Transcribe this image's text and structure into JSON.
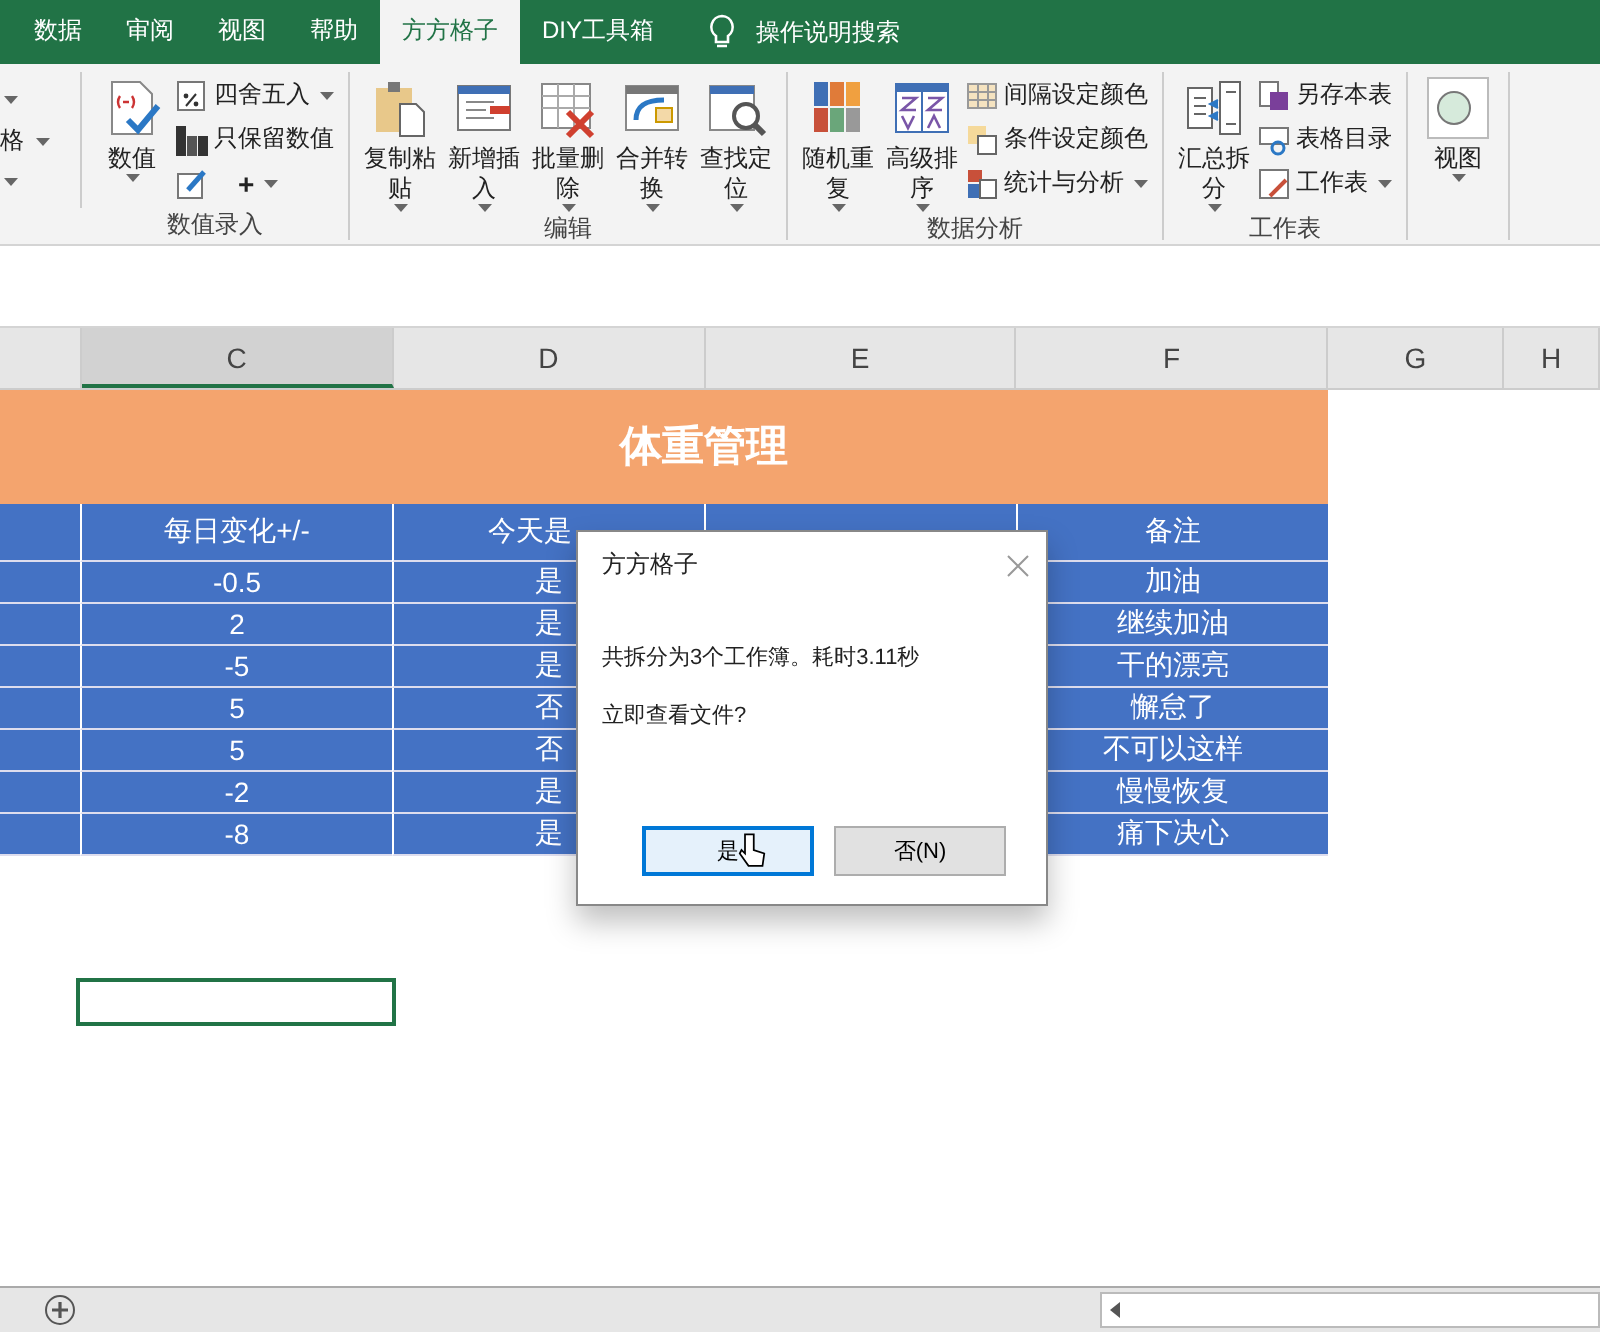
{
  "ribbon_tabs": [
    {
      "label": "数据",
      "selected": false
    },
    {
      "label": "审阅",
      "selected": false
    },
    {
      "label": "视图",
      "selected": false
    },
    {
      "label": "帮助",
      "selected": false
    },
    {
      "label": "方方格子",
      "selected": true
    },
    {
      "label": "DIY工具箱",
      "selected": false
    }
  ],
  "tell_me": "操作说明搜索",
  "ribbon": {
    "left_fragment": "格",
    "groups": [
      {
        "label": "数值录入",
        "items": [
          {
            "kind": "big",
            "label": "数值"
          },
          {
            "kind": "stack",
            "rows": [
              {
                "label": "四舍五入",
                "dropdown": true
              },
              {
                "label": "只保留数值",
                "dropdown": false
              },
              {
                "label": "+",
                "dropdown": true
              }
            ]
          }
        ]
      },
      {
        "label": "编辑",
        "items": [
          {
            "kind": "big",
            "label": "复制粘贴"
          },
          {
            "kind": "big",
            "label": "新增插入"
          },
          {
            "kind": "big",
            "label": "批量删除"
          },
          {
            "kind": "big",
            "label": "合并转换"
          },
          {
            "kind": "big",
            "label": "查找定位"
          }
        ]
      },
      {
        "label": "数据分析",
        "items": [
          {
            "kind": "big",
            "label": "随机重复"
          },
          {
            "kind": "big",
            "label": "高级排序"
          },
          {
            "kind": "stack",
            "rows": [
              {
                "label": "间隔设定颜色",
                "dropdown": false
              },
              {
                "label": "条件设定颜色",
                "dropdown": false
              },
              {
                "label": "统计与分析",
                "dropdown": true
              }
            ]
          }
        ]
      },
      {
        "label": "工作表",
        "items": [
          {
            "kind": "big",
            "label": "汇总拆分"
          },
          {
            "kind": "stack",
            "rows": [
              {
                "label": "另存本表",
                "dropdown": false
              },
              {
                "label": "表格目录",
                "dropdown": false
              },
              {
                "label": "工作表",
                "dropdown": true
              }
            ]
          }
        ]
      },
      {
        "items": [
          {
            "kind": "big",
            "label": "视图"
          }
        ]
      }
    ]
  },
  "columns": [
    {
      "label": "C",
      "selected": true
    },
    {
      "label": "D",
      "selected": false
    },
    {
      "label": "E",
      "selected": false
    },
    {
      "label": "F",
      "selected": false
    },
    {
      "label": "G",
      "selected": false
    },
    {
      "label": "H",
      "selected": false
    }
  ],
  "sheet": {
    "title": "体重管理",
    "headers": {
      "column_c": "每日变化+/-",
      "column_d": "今天是",
      "column_f": "备注"
    },
    "rows": [
      {
        "column_c": "-0.5",
        "column_d": "是",
        "column_f": "加油"
      },
      {
        "column_c": "2",
        "column_d": "是",
        "column_f": "继续加油"
      },
      {
        "column_c": "-5",
        "column_d": "是",
        "column_f": "干的漂亮"
      },
      {
        "column_c": "5",
        "column_d": "否",
        "column_f": "懈怠了"
      },
      {
        "column_c": "5",
        "column_d": "否",
        "column_f": "不可以这样"
      },
      {
        "column_c": "-2",
        "column_d": "是",
        "column_f": "慢慢恢复"
      },
      {
        "column_c": "-8",
        "column_d": "是",
        "column_f": "痛下决心"
      }
    ]
  },
  "dialog": {
    "title": "方方格子",
    "message": "共拆分为3个工作簿。耗时3.11秒",
    "question": "立即查看文件?",
    "buttons": [
      {
        "label": "是",
        "selected": true
      },
      {
        "label": "否(N)",
        "selected": false
      }
    ]
  }
}
